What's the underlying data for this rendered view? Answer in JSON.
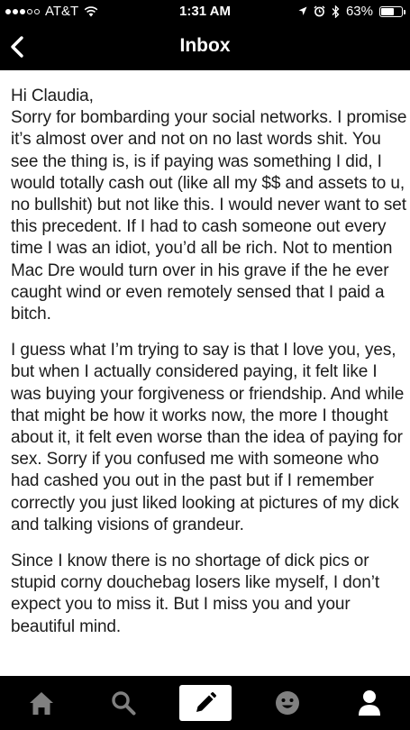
{
  "status_bar": {
    "carrier": "AT&T",
    "time": "1:31 AM",
    "battery": "63%",
    "battery_level": 0.63,
    "icons": [
      "signal-icon",
      "wifi-icon",
      "location-icon",
      "alarm-icon",
      "bluetooth-icon",
      "battery-icon"
    ]
  },
  "nav": {
    "title": "Inbox",
    "back_icon": "chevron-left-icon"
  },
  "message": {
    "paragraphs": [
      "Hi Claudia,\nSorry for bombarding your social networks. I promise it’s almost over and not on no last words shit. You see the thing is, is if paying was something I did, I would totally cash out (like all my $$ and assets to u, no bullshit) but not like this. I would never want to set this precedent. If I had to cash someone out every time I was an idiot, you’d all be rich. Not to mention Mac Dre would turn over in his grave if the he ever caught wind or even remotely sensed that I paid a bitch.",
      "I guess what I’m trying to say is that I love you, yes, but when I actually considered paying, it felt like I was buying your forgiveness or friendship. And while that might be how it works now, the more I thought about it, it felt even worse than the idea of paying for sex. Sorry if you confused me with someone who had cashed you out in the past but if I remember correctly you just liked looking at pictures of my dick and talking visions of grandeur.",
      "Since I know there is no shortage of dick pics or stupid corny douchebag losers like myself, I don’t expect you to miss it. But I miss you and your beautiful mind."
    ]
  },
  "tab_bar": {
    "tabs": [
      "home-icon",
      "search-icon",
      "compose-icon",
      "emoji-icon",
      "profile-icon"
    ],
    "active_tab": "compose-icon",
    "icon_color": "#808080",
    "active_bg": "#ffffff"
  }
}
